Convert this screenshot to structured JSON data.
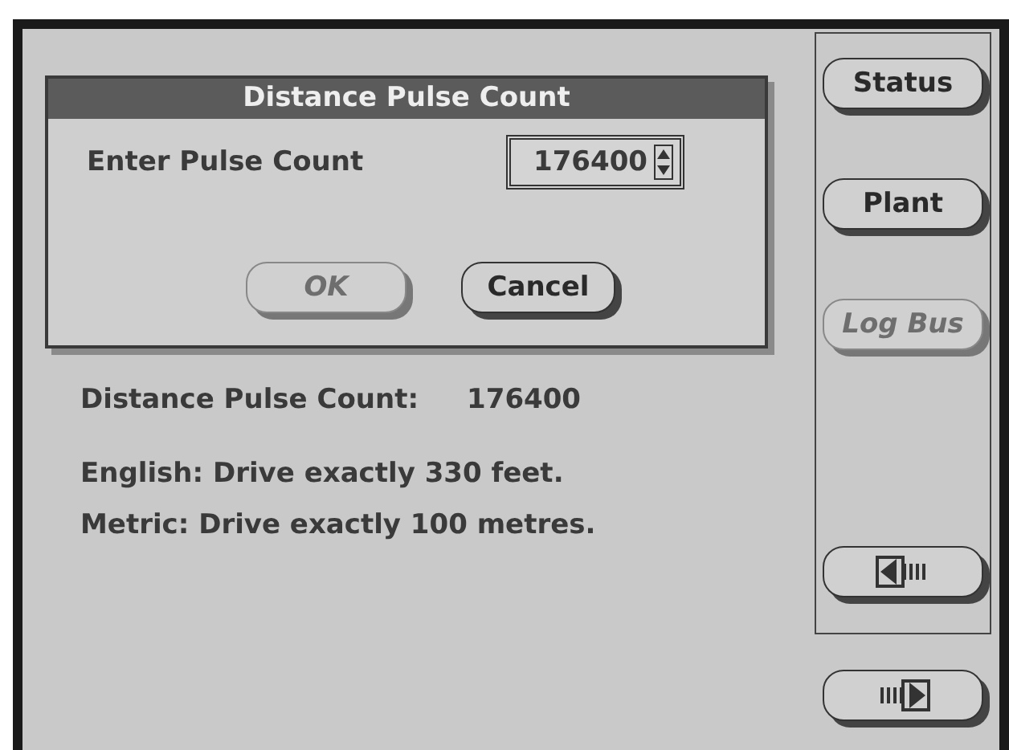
{
  "dialog": {
    "title": "Distance Pulse Count",
    "field_label": "Enter Pulse Count",
    "field_value": "176400",
    "buttons": [
      {
        "label": "OK",
        "disabled": true
      },
      {
        "label": "Cancel",
        "disabled": false
      }
    ]
  },
  "readout": {
    "label": "Distance Pulse Count:",
    "value": "176400"
  },
  "notes": [
    "English: Drive exactly 330 feet.",
    "Metric: Drive exactly 100 metres."
  ],
  "sidebar": {
    "buttons": [
      {
        "kind": "text",
        "label": "Status",
        "disabled": false
      },
      {
        "kind": "text",
        "label": "Plant",
        "disabled": false
      },
      {
        "kind": "text",
        "label": "Log Bus",
        "disabled": true
      },
      {
        "kind": "back"
      }
    ]
  },
  "next_button": {
    "kind": "forward"
  }
}
